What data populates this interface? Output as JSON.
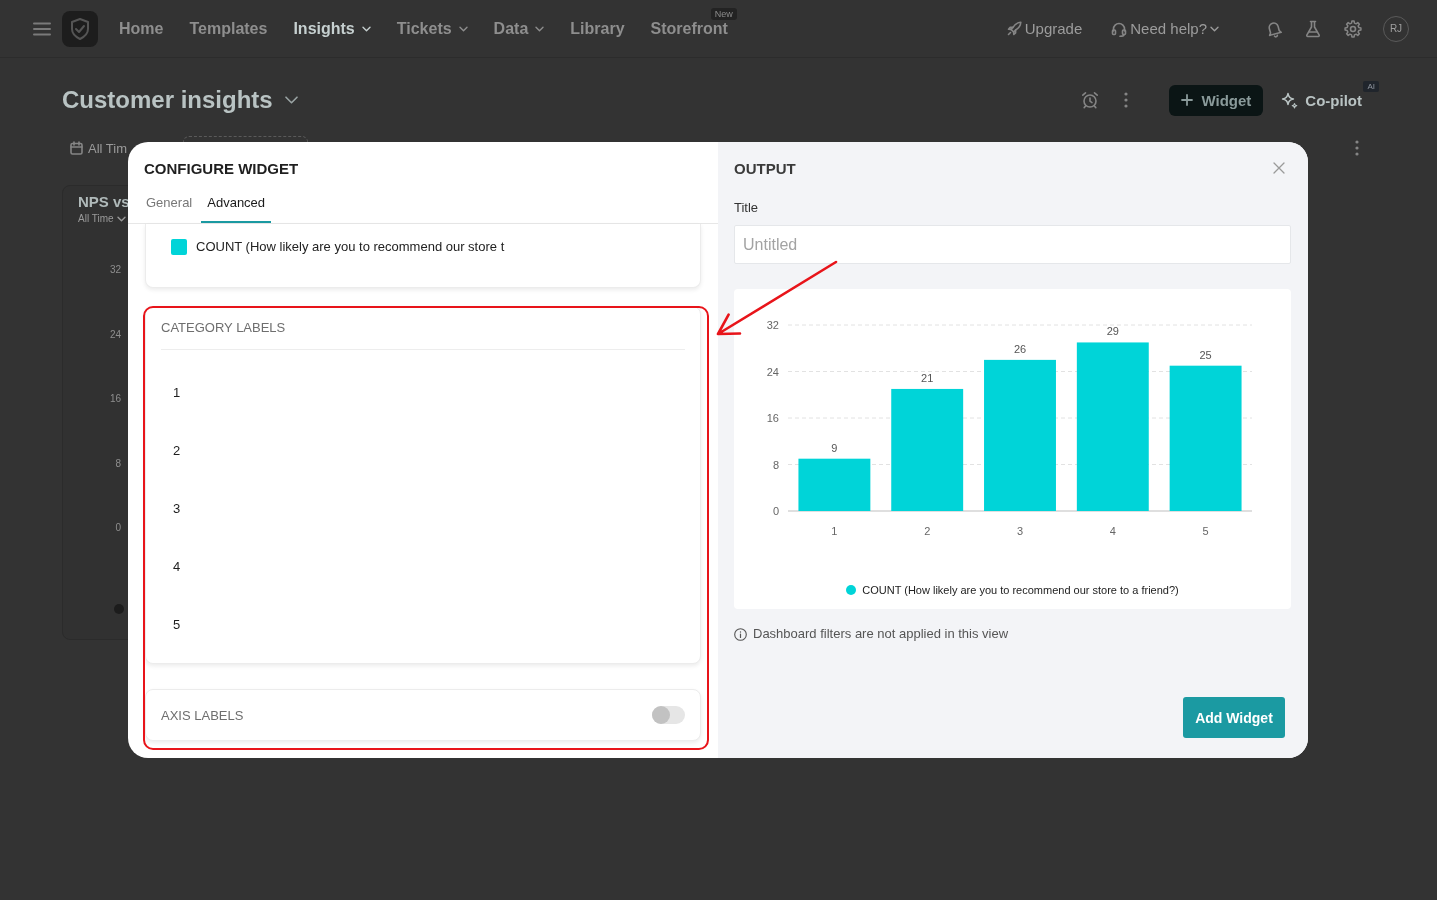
{
  "nav": {
    "items": [
      {
        "label": "Home",
        "selected": false,
        "caret": false
      },
      {
        "label": "Templates",
        "selected": false,
        "caret": false
      },
      {
        "label": "Insights",
        "selected": true,
        "caret": true
      },
      {
        "label": "Tickets",
        "selected": false,
        "caret": true
      },
      {
        "label": "Data",
        "selected": false,
        "caret": true
      },
      {
        "label": "Library",
        "selected": false,
        "caret": false
      },
      {
        "label": "Storefront",
        "selected": false,
        "caret": false,
        "badge": "New"
      }
    ],
    "links": [
      {
        "kind": "upgrade",
        "label": "Upgrade",
        "caret": false
      },
      {
        "kind": "help",
        "label": "Need help?",
        "caret": true
      }
    ],
    "avatar": "RJ"
  },
  "header": {
    "title": "Customer insights",
    "add_button": "Widget",
    "copilot": {
      "label": "Co-pilot",
      "badge": "AI"
    }
  },
  "filter": {
    "date": "All Tim"
  },
  "background_card": {
    "title": "NPS vs",
    "subtitle": "All Time",
    "axis_labels": [
      "32",
      "24",
      "16",
      "8",
      "0"
    ]
  },
  "modal": {
    "configure": {
      "title": "CONFIGURE WIDGET",
      "tabs": [
        {
          "label": "General",
          "selected": false
        },
        {
          "label": "Advanced",
          "selected": true
        }
      ],
      "series": [
        {
          "label": "COUNT (How likely are you to recommend our store t",
          "color": "#00d4d8"
        }
      ],
      "category_labels": {
        "heading": "CATEGORY LABELS",
        "items": [
          "1",
          "2",
          "3",
          "4",
          "5"
        ]
      },
      "axis_labels": {
        "heading": "AXIS LABELS",
        "on": false
      }
    },
    "output": {
      "title": "OUTPUT",
      "title_field": {
        "label": "Title",
        "placeholder": "Untitled"
      },
      "chart_data": {
        "type": "bar",
        "categories": [
          "1",
          "2",
          "3",
          "4",
          "5"
        ],
        "series": [
          {
            "name": "COUNT (How likely are you to recommend our store to a friend?)",
            "color": "#00d4d8",
            "values": [
              9,
              21,
              26,
              29,
              25
            ]
          }
        ],
        "ylim": [
          0,
          32
        ],
        "yticks": [
          0,
          8,
          16,
          24,
          32
        ],
        "grid": true,
        "data_labels": true
      },
      "note": "Dashboard filters are not applied in this view",
      "primary_button": "Add Widget"
    }
  },
  "annotation": {
    "frame": true,
    "arrow": true
  }
}
